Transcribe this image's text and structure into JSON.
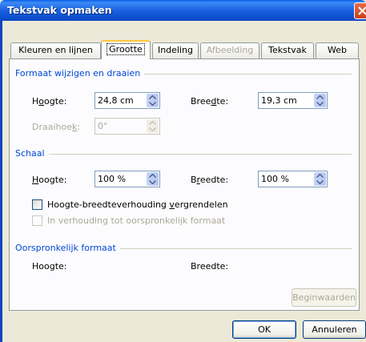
{
  "window": {
    "title": "Tekstvak opmaken"
  },
  "tabs": [
    {
      "label": "Kleuren en lijnen",
      "state": "normal"
    },
    {
      "label": "Grootte",
      "state": "active"
    },
    {
      "label": "Indeling",
      "state": "normal"
    },
    {
      "label": "Afbeelding",
      "state": "disabled"
    },
    {
      "label": "Tekstvak",
      "state": "normal"
    },
    {
      "label": "Web",
      "state": "normal"
    }
  ],
  "formaat": {
    "section_title": "Formaat wijzigen en draaien",
    "hoogte_label_pre": "H",
    "hoogte_label_ul": "o",
    "hoogte_label_post": "ogte:",
    "hoogte_value": "24,8 cm",
    "breedte_label_pre": "Bree",
    "breedte_label_ul": "d",
    "breedte_label_post": "te:",
    "breedte_value": "19,3 cm",
    "draaihoek_label_pre": "Draaihoe",
    "draaihoek_label_ul": "k",
    "draaihoek_label_post": ":",
    "draaihoek_value": "0°"
  },
  "schaal": {
    "section_title": "Schaal",
    "hoogte_label_pre": "",
    "hoogte_label_ul": "H",
    "hoogte_label_post": "oogte:",
    "hoogte_value": "100 %",
    "breedte_label_pre": "B",
    "breedte_label_ul": "r",
    "breedte_label_post": "eedte:",
    "breedte_value": "100 %",
    "lock_ratio_pre": "Hoogte-breedteverhouding ",
    "lock_ratio_ul": "v",
    "lock_ratio_post": "ergrendelen",
    "relative_original": "In verhouding tot oorspronkelijk formaat"
  },
  "oorspronkelijk": {
    "section_title": "Oorspronkelijk formaat",
    "hoogte_label": "Hoogte:",
    "breedte_label": "Breedte:",
    "reset_button": "Beginwaarden"
  },
  "footer": {
    "ok_button": "OK",
    "cancel_button": "Annuleren"
  }
}
